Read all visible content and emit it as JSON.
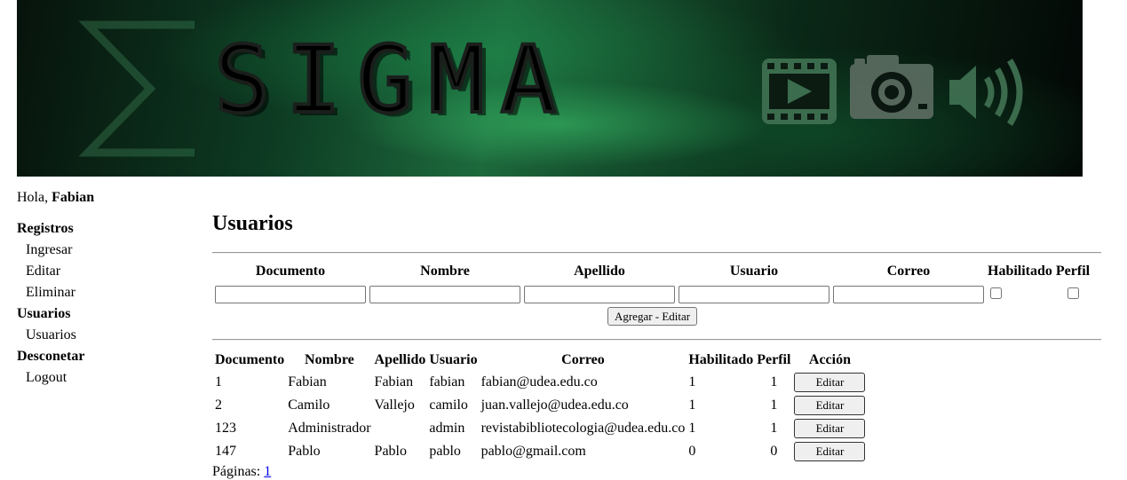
{
  "banner": {
    "title": "SIGMA"
  },
  "greeting": {
    "prefix": "Hola, ",
    "user": "Fabian"
  },
  "menu": [
    {
      "group": "Registros",
      "items": [
        "Ingresar",
        "Editar",
        "Eliminar"
      ]
    },
    {
      "group": "Usuarios",
      "items": [
        "Usuarios"
      ]
    },
    {
      "group": "Desconetar",
      "items": [
        "Logout"
      ]
    }
  ],
  "page": {
    "title": "Usuarios"
  },
  "form": {
    "headers": [
      "Documento",
      "Nombre",
      "Apellido",
      "Usuario",
      "Correo",
      "Habilitado",
      "Perfil"
    ],
    "values": {
      "documento": "",
      "nombre": "",
      "apellido": "",
      "usuario": "",
      "correo": ""
    },
    "habilitado_checked": false,
    "perfil_checked": false,
    "submit_label": "Agregar - Editar"
  },
  "table": {
    "headers": [
      "Documento",
      "Nombre",
      "Apellido",
      "Usuario",
      "Correo",
      "Habilitado",
      "Perfil",
      "Acción"
    ],
    "rows": [
      {
        "documento": "1",
        "nombre": "Fabian",
        "apellido": "Fabian",
        "usuario": "fabian",
        "correo": "fabian@udea.edu.co",
        "habilitado": "1",
        "perfil": "1",
        "accion": "Editar"
      },
      {
        "documento": "2",
        "nombre": "Camilo",
        "apellido": "Vallejo",
        "usuario": "camilo",
        "correo": "juan.vallejo@udea.edu.co",
        "habilitado": "1",
        "perfil": "1",
        "accion": "Editar"
      },
      {
        "documento": "123",
        "nombre": "Administrador",
        "apellido": "",
        "usuario": "admin",
        "correo": "revistabibliotecologia@udea.edu.co",
        "habilitado": "1",
        "perfil": "1",
        "accion": "Editar"
      },
      {
        "documento": "147",
        "nombre": "Pablo",
        "apellido": "Pablo",
        "usuario": "pablo",
        "correo": "pablo@gmail.com",
        "habilitado": "0",
        "perfil": "0",
        "accion": "Editar"
      }
    ]
  },
  "pager": {
    "label": "Páginas: ",
    "pages": [
      "1"
    ]
  },
  "colors": {
    "banner_dark": "#07130c",
    "banner_green": "#1d6a3d",
    "icon_green": "#3a6b4c",
    "link": "#0000ee"
  },
  "icons": [
    "sigma-logo-icon",
    "film-play-icon",
    "camera-icon",
    "speaker-volume-icon"
  ]
}
